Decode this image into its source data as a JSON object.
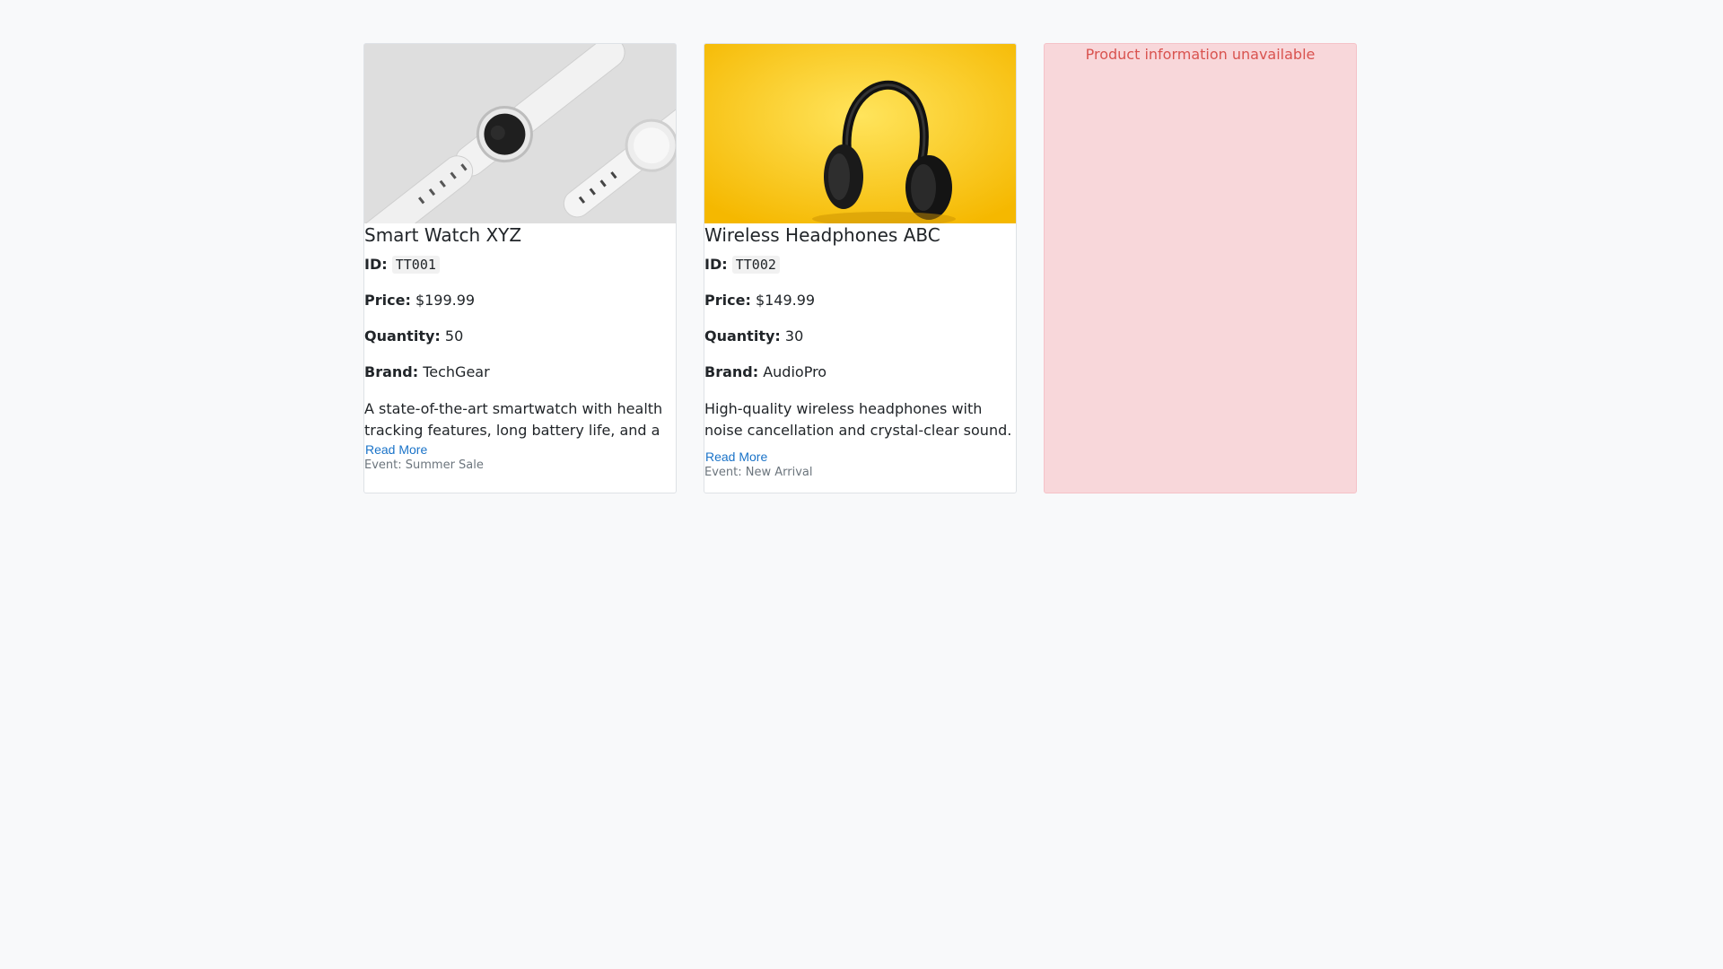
{
  "products": [
    {
      "name": "Smart Watch XYZ",
      "id_label": "ID:",
      "id": "TT001",
      "price_label": "Price:",
      "price": "$199.99",
      "quantity_label": "Quantity:",
      "quantity": "50",
      "brand_label": "Brand:",
      "brand": "TechGear",
      "description": "A state-of-the-art smartwatch with health tracking features, long battery life, and a sleek design.",
      "read_more": "Read More",
      "event": "Event: Summer Sale",
      "image_icon": "smartwatch-image"
    },
    {
      "name": "Wireless Headphones ABC",
      "id_label": "ID:",
      "id": "TT002",
      "price_label": "Price:",
      "price": "$149.99",
      "quantity_label": "Quantity:",
      "quantity": "30",
      "brand_label": "Brand:",
      "brand": "AudioPro",
      "description": "High-quality wireless headphones with noise cancellation and crystal-clear sound.",
      "read_more": "Read More",
      "event": "Event: New Arrival",
      "image_icon": "headphones-image"
    }
  ],
  "error_card": {
    "message": "Product information unavailable"
  },
  "colors": {
    "page_background": "#f8f9fa",
    "link": "#1a73c8",
    "error_background": "#f8d7da",
    "error_text": "#d9534f",
    "muted": "#6c757d"
  }
}
